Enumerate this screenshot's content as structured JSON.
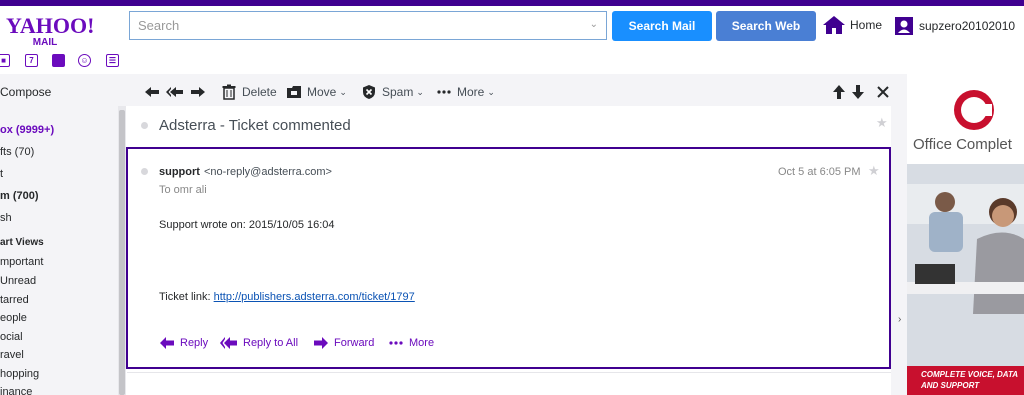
{
  "brand": {
    "logo_text": "YAHOO!",
    "logo_sub": "MAIL"
  },
  "apps": [
    {
      "name": "contacts-icon",
      "glyph": "👤"
    },
    {
      "name": "calendar-icon",
      "glyph": "7"
    },
    {
      "name": "notepad-icon",
      "glyph": "▤"
    },
    {
      "name": "messenger-icon",
      "glyph": "☺"
    },
    {
      "name": "newsfeed-icon",
      "glyph": "☰"
    }
  ],
  "search": {
    "placeholder": "Search",
    "value": "",
    "search_mail_label": "Search Mail",
    "search_web_label": "Search Web"
  },
  "header": {
    "home_label": "Home",
    "username": "supzero20102010"
  },
  "sidebar": {
    "compose": "Compose",
    "folders": [
      "ox (9999+)",
      "fts (70)",
      "t",
      "m (700)",
      "sh"
    ],
    "smart_views_label": "art Views",
    "views": [
      "mportant",
      "Unread",
      "tarred",
      "eople",
      "ocial",
      "ravel",
      "hopping",
      "inance"
    ]
  },
  "toolbar": {
    "delete_label": "Delete",
    "move_label": "Move",
    "spam_label": "Spam",
    "more_label": "More"
  },
  "message": {
    "subject": "Adsterra - Ticket commented",
    "sender_name": "support",
    "sender_email": "<no-reply@adsterra.com>",
    "to_line": "To  omr ali",
    "date": "Oct 5 at 6:05 PM",
    "body_line1": "Support wrote on: 2015/10/05 16:04",
    "link_prefix": "Ticket link: ",
    "link_url": "http://publishers.adsterra.com/ticket/1797"
  },
  "actions": {
    "reply": "Reply",
    "reply_all": "Reply to All",
    "forward": "Forward",
    "more": "More"
  },
  "ad": {
    "title": "Office Complet",
    "caption_line1": "COMPLETE VOICE, DATA",
    "caption_line2": "AND SUPPORT"
  },
  "colors": {
    "brand_purple": "#400090",
    "accent_purple": "#6b0bbd",
    "search_blue": "#198fff",
    "web_blue": "#4a7fd4",
    "ad_red": "#c8102e"
  }
}
